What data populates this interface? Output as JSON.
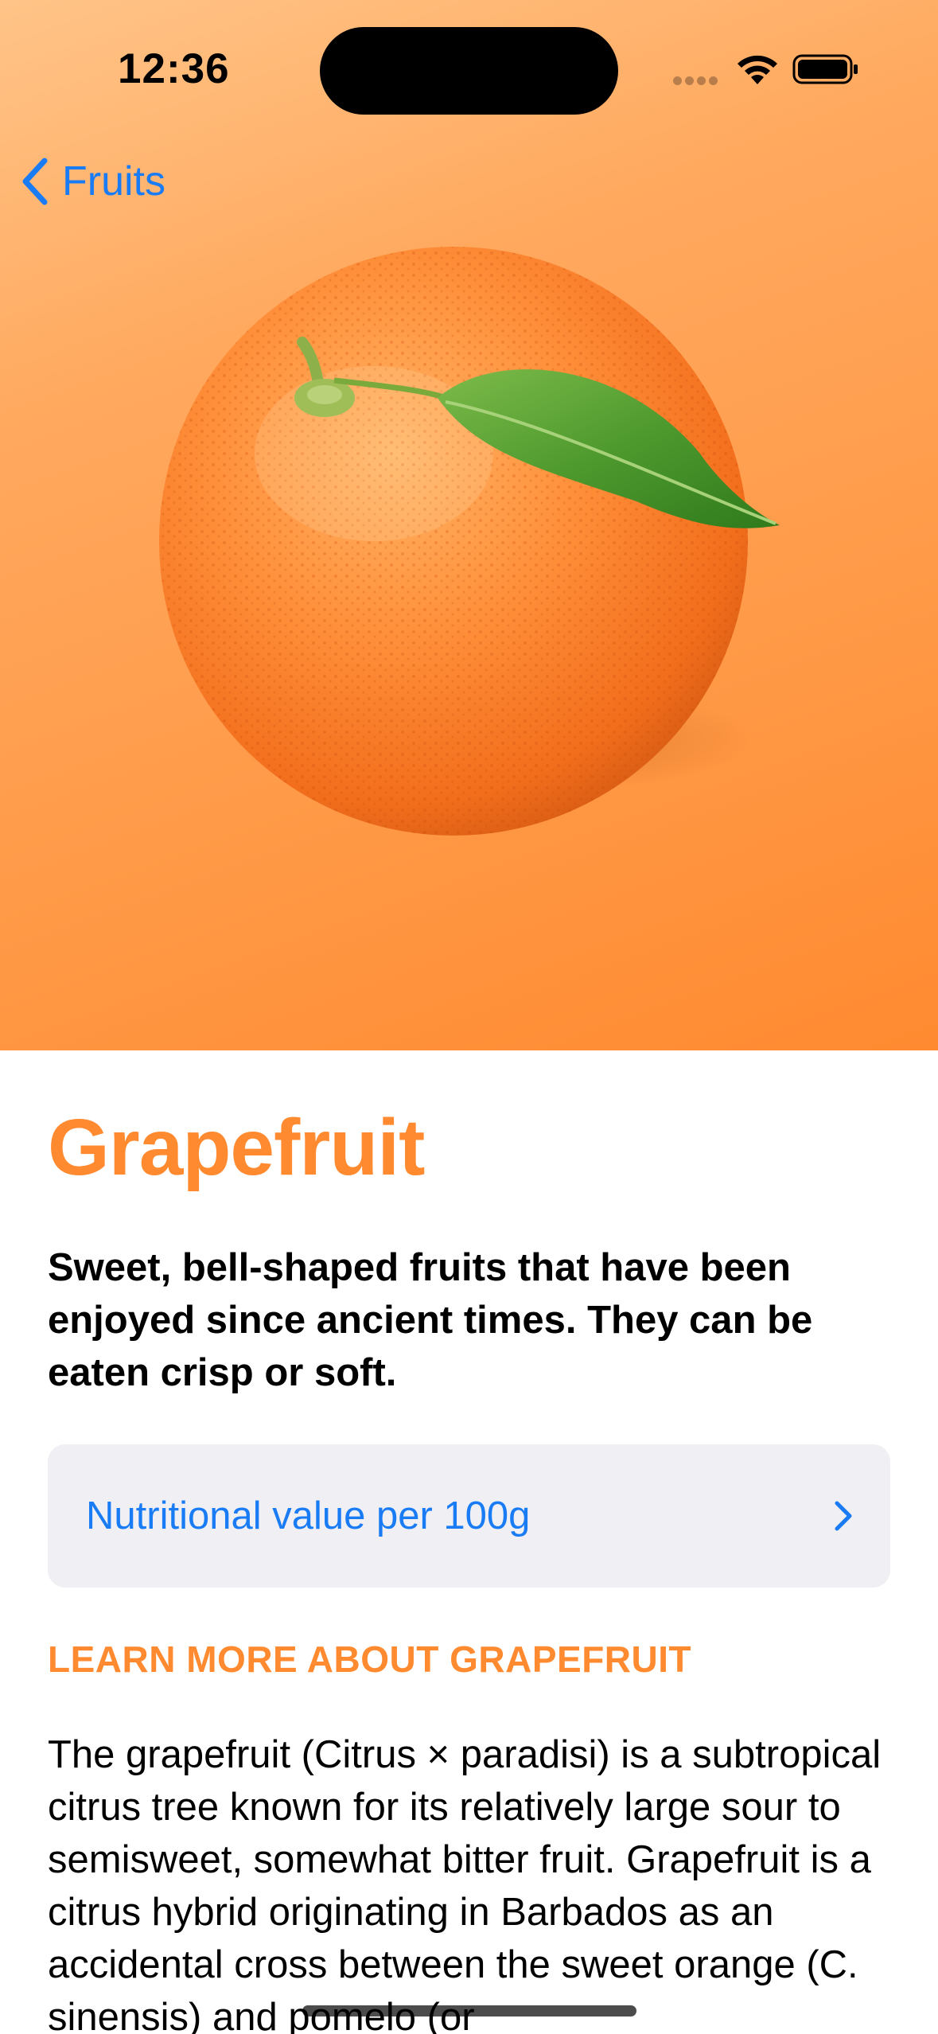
{
  "status_bar": {
    "time": "12:36"
  },
  "nav": {
    "back_label": "Fruits"
  },
  "hero": {
    "gradient_start": "#ffc488",
    "gradient_end": "#ff8a30",
    "image_icon": "grapefruit-illustration"
  },
  "fruit": {
    "name": "Grapefruit",
    "headline": "Sweet, bell-shaped fruits that have been enjoyed since ancient times. They can be eaten crisp or soft.",
    "nutrition_label": "Nutritional value per 100g",
    "learn_more_header": "LEARN MORE ABOUT GRAPEFRUIT",
    "description": "The grapefruit (Citrus × paradisi) is a subtropical citrus tree known for its relatively large sour to semisweet, somewhat bitter fruit. Grapefruit is a citrus hybrid originating in Barbados as an accidental cross between the sweet orange (C. sinensis) and pomelo (or"
  },
  "colors": {
    "accent": "#ff8a30",
    "link": "#1a7cf5",
    "row_background": "#efeff4"
  }
}
